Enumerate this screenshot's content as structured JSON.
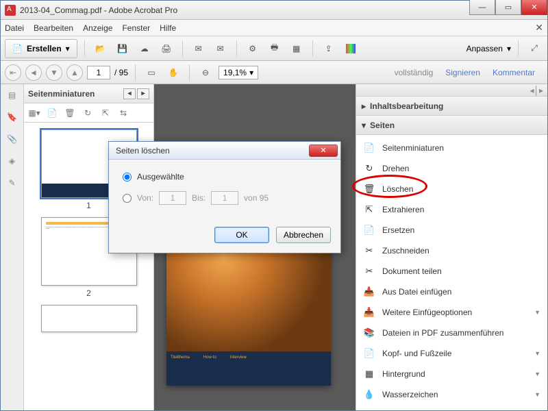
{
  "titlebar": {
    "filename": "2013-04_Commag.pdf",
    "app": "Adobe Acrobat Pro"
  },
  "menu": {
    "file": "Datei",
    "edit": "Bearbeiten",
    "view": "Anzeige",
    "window": "Fenster",
    "help": "Hilfe"
  },
  "toolbar": {
    "create": "Erstellen",
    "customize": "Anpassen"
  },
  "nav": {
    "page": "1",
    "total": "95",
    "zoom": "19,1%",
    "full": "vollständig",
    "sign": "Signieren",
    "comment": "Kommentar"
  },
  "thumbs": {
    "title": "Seitenminiaturen",
    "pages": [
      "1",
      "2"
    ]
  },
  "right": {
    "sec_content": "Inhaltsbearbeitung",
    "sec_pages": "Seiten",
    "items": [
      {
        "label": "Seitenminiaturen",
        "chev": false
      },
      {
        "label": "Drehen",
        "chev": false
      },
      {
        "label": "Löschen",
        "chev": false
      },
      {
        "label": "Extrahieren",
        "chev": false
      },
      {
        "label": "Ersetzen",
        "chev": false
      },
      {
        "label": "Zuschneiden",
        "chev": false
      },
      {
        "label": "Dokument teilen",
        "chev": false
      },
      {
        "label": "Aus Datei einfügen",
        "chev": false
      },
      {
        "label": "Weitere Einfügeoptionen",
        "chev": true
      },
      {
        "label": "Dateien in PDF zusammenführen",
        "chev": false
      },
      {
        "label": "Kopf- und Fußzeile",
        "chev": true
      },
      {
        "label": "Hintergrund",
        "chev": true
      },
      {
        "label": "Wasserzeichen",
        "chev": true
      }
    ]
  },
  "dialog": {
    "title": "Seiten löschen",
    "opt_selected": "Ausgewählte",
    "opt_from": "Von:",
    "to": "Bis:",
    "of": "von 95",
    "from_val": "1",
    "to_val": "1",
    "ok": "OK",
    "cancel": "Abbrechen"
  }
}
